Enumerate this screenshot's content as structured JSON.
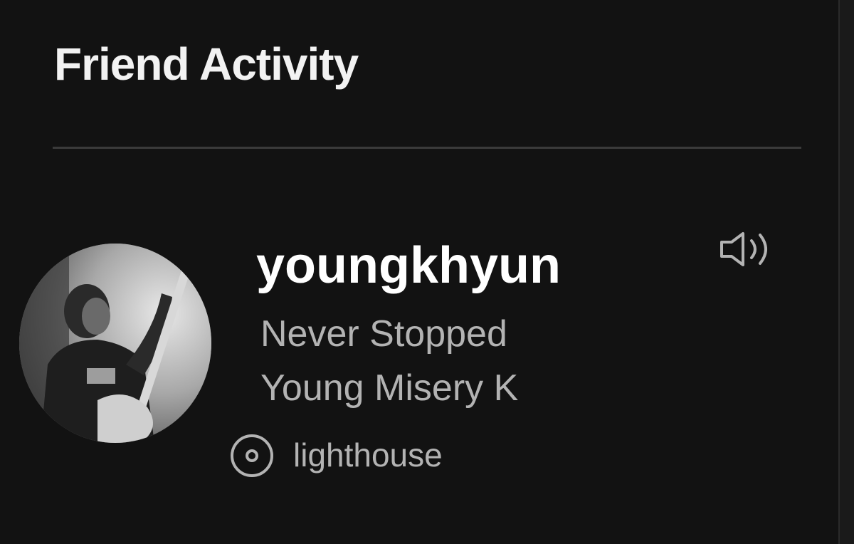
{
  "header": {
    "title": "Friend Activity"
  },
  "friend": {
    "username": "youngkhyun",
    "track": "Never Stopped",
    "artist": "Young Misery K",
    "context": "lighthouse",
    "avatar_icon": "avatar-photo",
    "status_icon": "speaker-icon",
    "context_icon": "disc-icon"
  },
  "colors": {
    "background": "#121212",
    "primary_text": "#ffffff",
    "secondary_text": "#b3b3b3"
  }
}
